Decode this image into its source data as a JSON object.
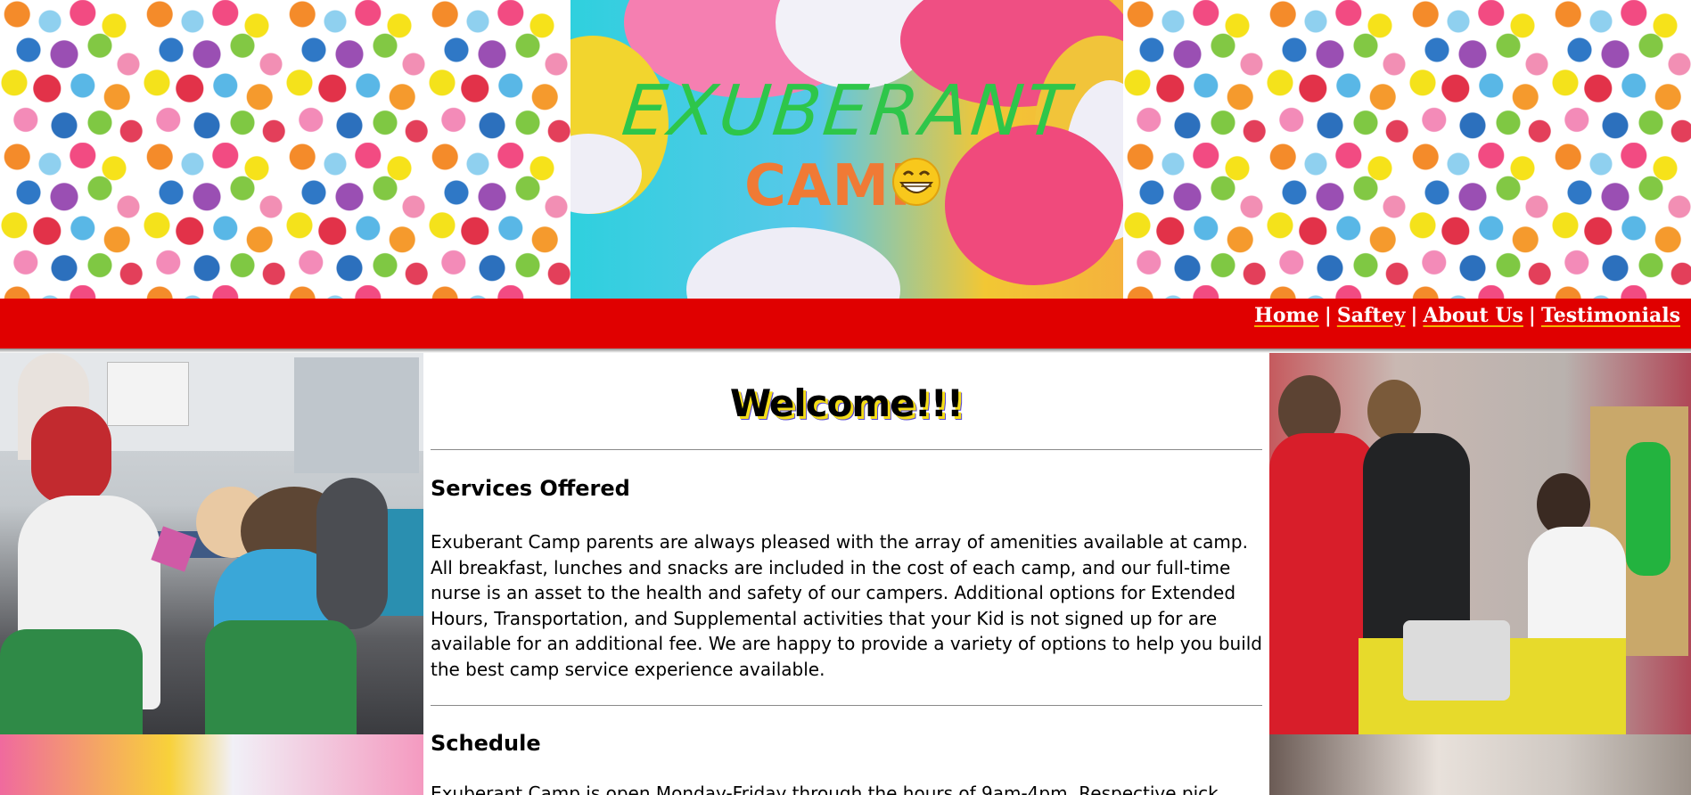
{
  "header": {
    "logo_title": "EXUBERANT",
    "logo_subtitle": "CAMP"
  },
  "nav": {
    "items": [
      "Home",
      "Saftey",
      "About Us",
      "Testimonials"
    ],
    "separator": "|"
  },
  "main": {
    "welcome": "Welcome!!!",
    "services_title": "Services Offered",
    "services_text": "Exuberant Camp parents are always pleased with the array of amenities available at camp. All breakfast, lunches and snacks are included in the cost of each camp, and our full-time nurse is an asset to the health and safety of our campers. Additional options for Extended Hours, Transportation, and Supplemental activities that your Kid is not signed up for are available for an additional fee. We are happy to provide a variety of options to help you build the best camp service experience available.",
    "schedule_title": "Schedule",
    "schedule_text": "Exuberant Camp is open Monday-Friday through the hours of 9am-4pm. Respective pick"
  },
  "colors": {
    "nav_bar": "#e00000",
    "logo_title": "#2ec64a",
    "logo_camp": "#f07a35",
    "welcome_shadow_yellow": "#f4dd18",
    "welcome_shadow_blue": "#5a4bd8"
  },
  "icons": {
    "logo_smile": "grinning-face-icon"
  }
}
